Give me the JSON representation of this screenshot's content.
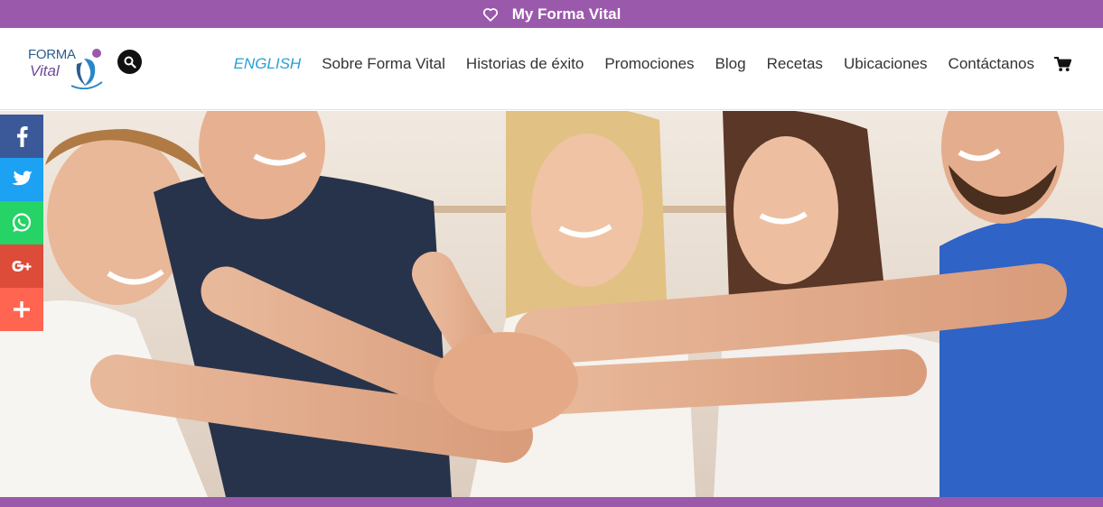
{
  "topbar": {
    "label": "My Forma Vital",
    "icon": "heart-outline-icon"
  },
  "logo": {
    "line1": "FORMA",
    "line2": "Vital"
  },
  "search": {
    "icon": "search-icon"
  },
  "nav": {
    "items": [
      {
        "label": "ENGLISH"
      },
      {
        "label": "Sobre Forma Vital"
      },
      {
        "label": "Historias de éxito"
      },
      {
        "label": "Promociones"
      },
      {
        "label": "Blog"
      },
      {
        "label": "Recetas"
      },
      {
        "label": "Ubicaciones"
      },
      {
        "label": "Contáctanos"
      }
    ],
    "cart_icon": "shopping-cart-icon"
  },
  "share": [
    {
      "icon": "facebook-icon",
      "color": "#3b5998"
    },
    {
      "icon": "twitter-icon",
      "color": "#1da1f2"
    },
    {
      "icon": "whatsapp-icon",
      "color": "#25d366"
    },
    {
      "icon": "google-plus-icon",
      "color": "#dd4b39"
    },
    {
      "icon": "plus-icon",
      "color": "#ff6550"
    }
  ],
  "colors": {
    "brand_purple": "#9b59ab",
    "nav_active": "#2a9fd6",
    "nav_text": "#333333"
  }
}
